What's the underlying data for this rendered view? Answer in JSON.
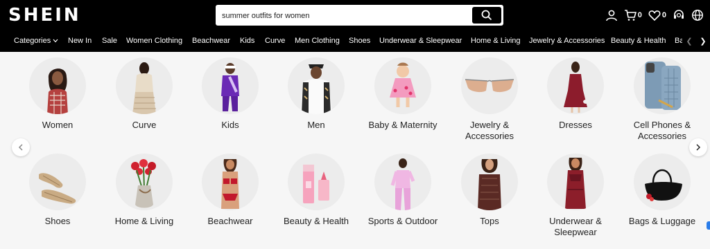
{
  "header": {
    "logo": "SHEIN",
    "search_value": "summer outfits for women",
    "cart_count": "0",
    "wishlist_count": "0"
  },
  "nav": {
    "items": [
      "Categories",
      "New In",
      "Sale",
      "Women Clothing",
      "Beachwear",
      "Kids",
      "Curve",
      "Men Clothing",
      "Shoes",
      "Underwear & Sleepwear",
      "Home & Living",
      "Jewelry & Accessories",
      "Beauty & Health",
      "Ba"
    ]
  },
  "categories": [
    {
      "label": "Women",
      "icon": "woman-photo"
    },
    {
      "label": "Curve",
      "icon": "curve-photo"
    },
    {
      "label": "Kids",
      "icon": "kids-photo"
    },
    {
      "label": "Men",
      "icon": "men-photo"
    },
    {
      "label": "Baby & Maternity",
      "icon": "baby-photo"
    },
    {
      "label": "Jewelry & Accessories",
      "icon": "sunglasses-photo"
    },
    {
      "label": "Dresses",
      "icon": "dress-photo"
    },
    {
      "label": "Cell Phones & Accessories",
      "icon": "phone-case-photo"
    },
    {
      "label": "Shoes",
      "icon": "shoes-photo"
    },
    {
      "label": "Home & Living",
      "icon": "flowers-vase-photo"
    },
    {
      "label": "Beachwear",
      "icon": "bikini-photo"
    },
    {
      "label": "Beauty & Health",
      "icon": "cosmetics-photo"
    },
    {
      "label": "Sports & Outdoor",
      "icon": "sportswear-photo"
    },
    {
      "label": "Tops",
      "icon": "top-photo"
    },
    {
      "label": "Underwear & Sleepwear",
      "icon": "lingerie-photo"
    },
    {
      "label": "Bags & Luggage",
      "icon": "handbag-photo"
    }
  ],
  "colors": {
    "header_bg": "#000000",
    "page_bg": "#f6f6f6",
    "thumb_bg": "#ececec"
  }
}
